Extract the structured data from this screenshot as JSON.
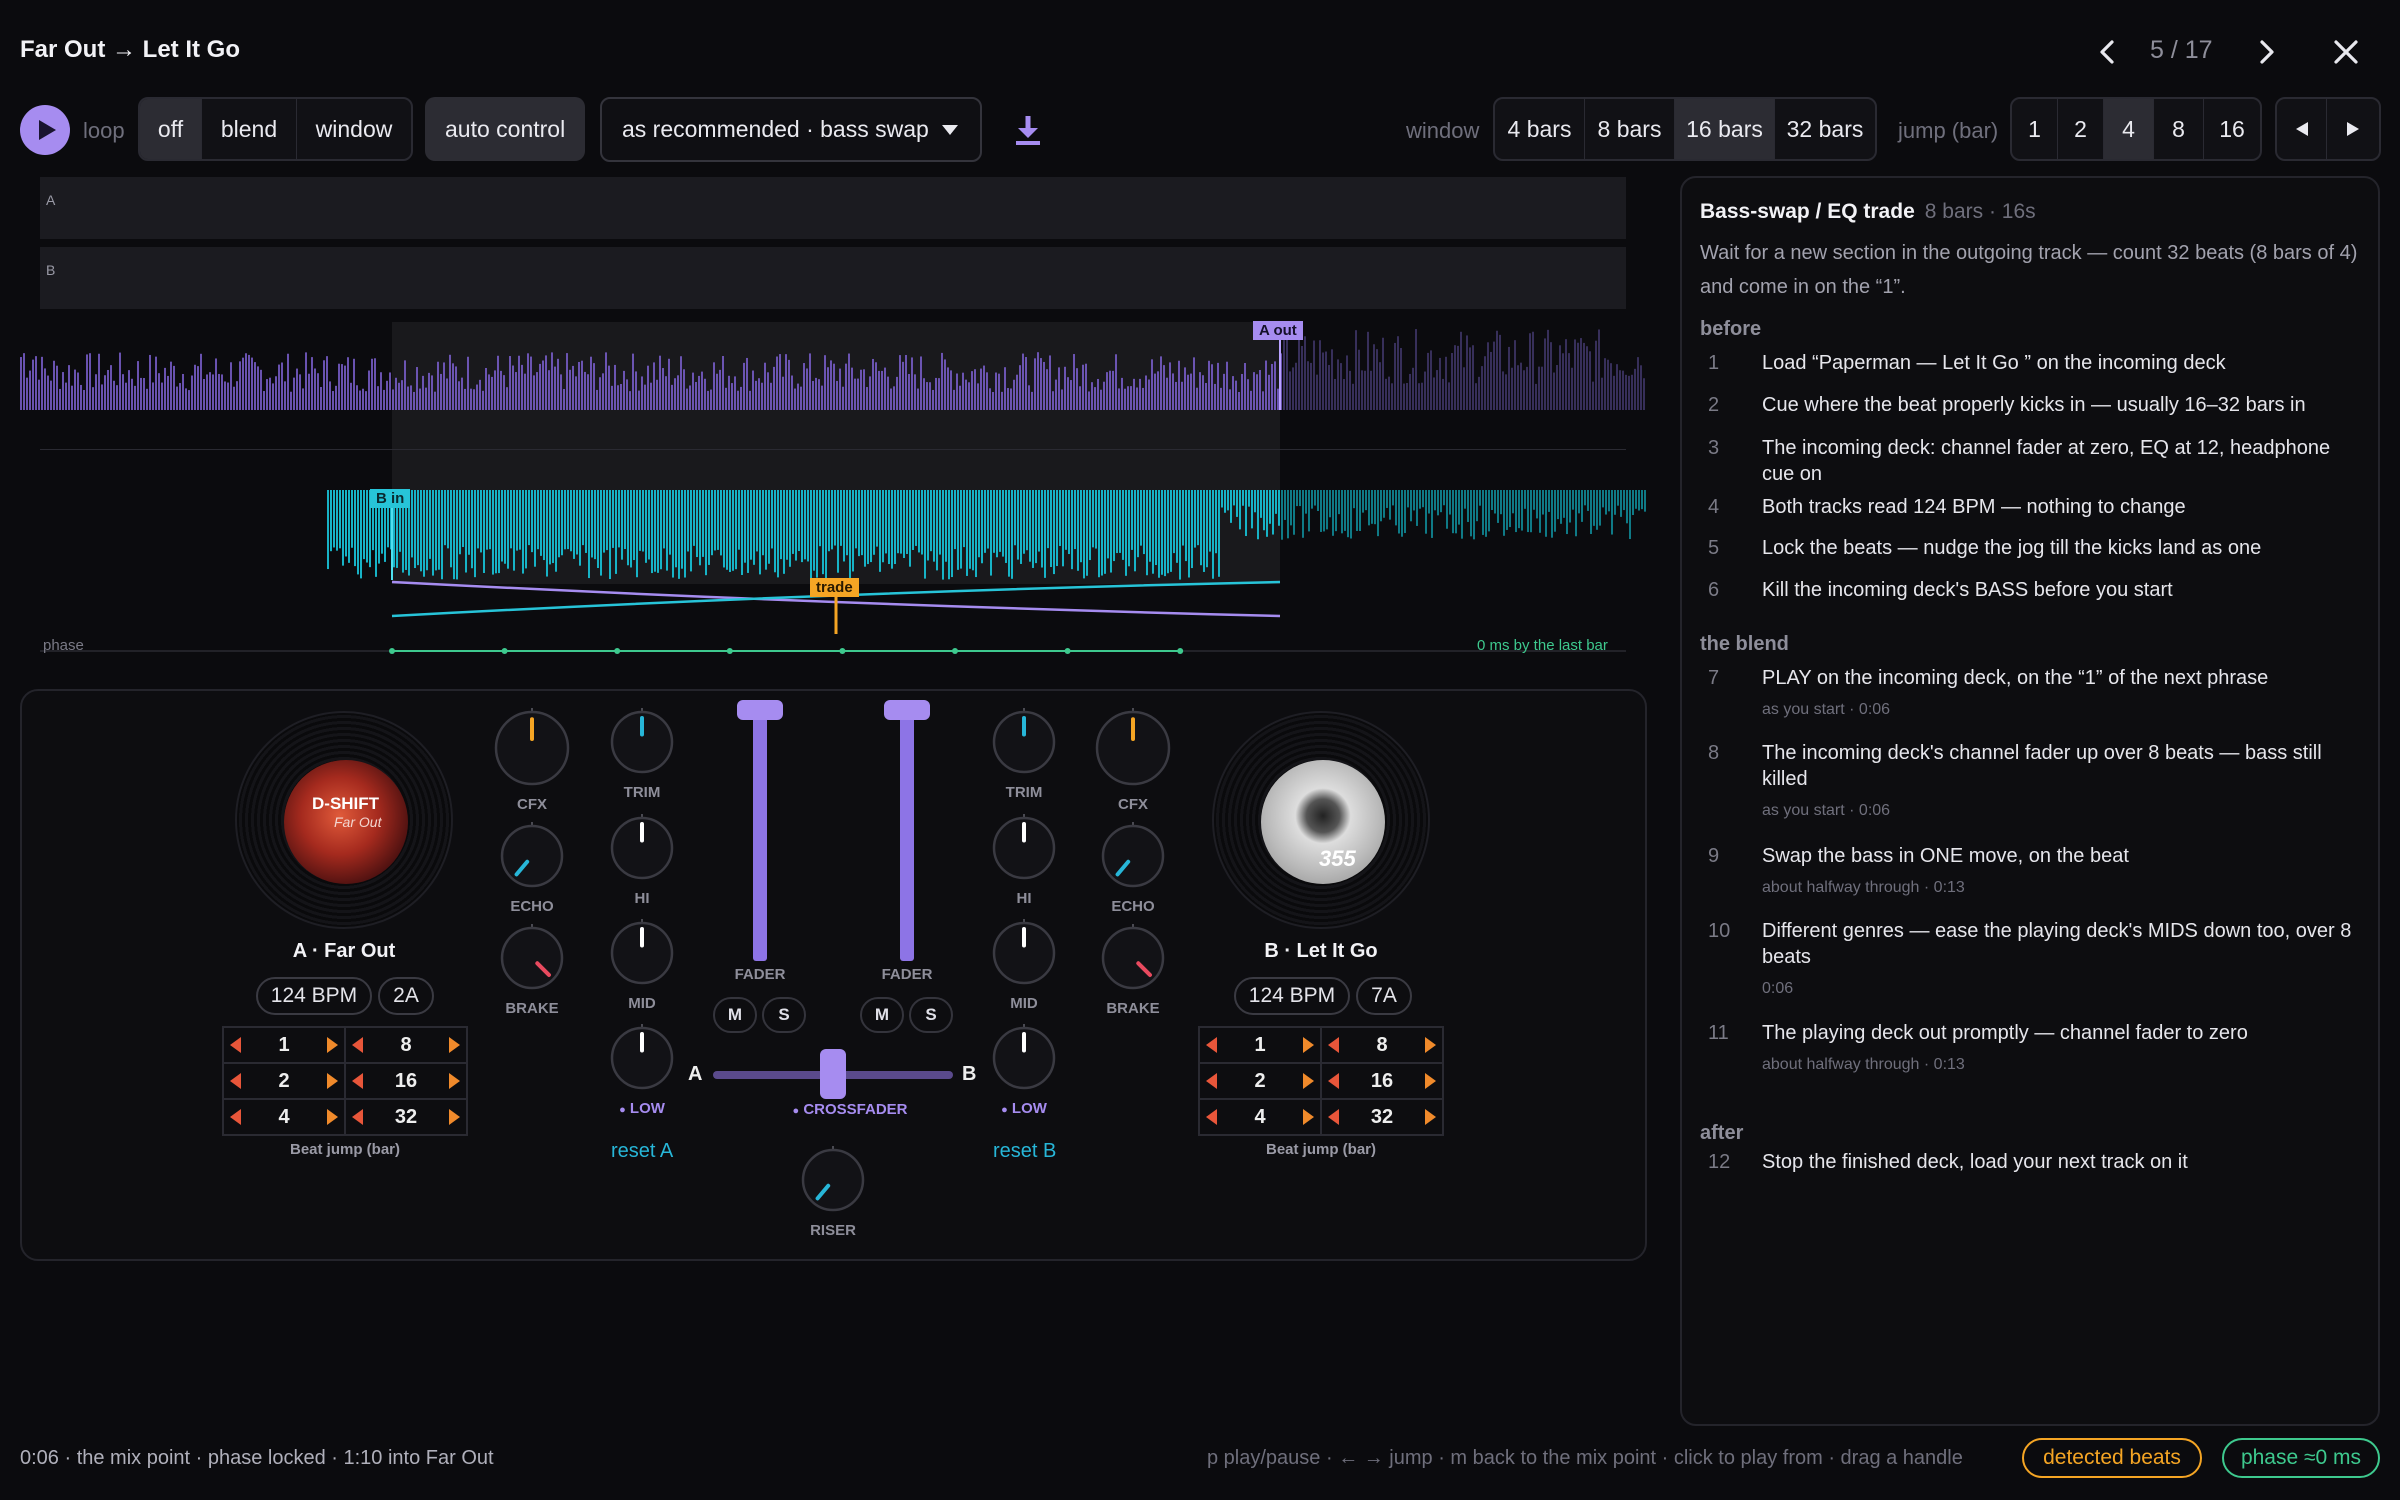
{
  "header": {
    "title": "Far Out → Let It Go",
    "pager": "5 / 17"
  },
  "toolbar": {
    "loop_label": "loop",
    "loop_options": [
      "off",
      "blend",
      "window"
    ],
    "loop_selected": "off",
    "auto_control": "auto control",
    "recommendation": "as recommended · bass swap",
    "window_label": "window",
    "window_options": [
      "4 bars",
      "8 bars",
      "16 bars",
      "32 bars"
    ],
    "window_selected": "16 bars",
    "jump_label": "jump (bar)",
    "jump_options": [
      "1",
      "2",
      "4",
      "8",
      "16"
    ],
    "jump_selected": "4"
  },
  "timeline": {
    "lane_a": "A",
    "lane_b": "B",
    "marker_a_out": "A out",
    "marker_b_in": "B in",
    "marker_trade": "trade",
    "phase_label": "phase",
    "phase_value": "0 ms by the last bar"
  },
  "deck_a": {
    "name": "A · Far Out",
    "bpm": "124 BPM",
    "key": "2A",
    "art_text_1": "D-SHIFT",
    "art_text_2": "Far Out",
    "jumps_left": [
      "1",
      "2",
      "4"
    ],
    "jumps_right": [
      "8",
      "16",
      "32"
    ],
    "beat_jump_label": "Beat jump (bar)",
    "reset": "reset A"
  },
  "deck_b": {
    "name": "B · Let It Go",
    "bpm": "124 BPM",
    "key": "7A",
    "art_text_1": "355",
    "jumps_left": [
      "1",
      "2",
      "4"
    ],
    "jumps_right": [
      "8",
      "16",
      "32"
    ],
    "beat_jump_label": "Beat jump (bar)",
    "reset": "reset B"
  },
  "mixer": {
    "cfx": "CFX",
    "echo": "ECHO",
    "brake": "BRAKE",
    "trim": "TRIM",
    "hi": "HI",
    "mid": "MID",
    "low": "LOW",
    "fader": "FADER",
    "mute": "M",
    "solo": "S",
    "crossfader": "CROSSFADER",
    "cf_a": "A",
    "cf_b": "B",
    "riser": "RISER"
  },
  "steps": {
    "title": "Bass-swap / EQ trade",
    "subtitle": "8 bars · 16s",
    "description": "Wait for a new section in the outgoing track — count 32 beats (8 bars of 4) and come in on the “1”.",
    "sections": [
      {
        "name": "before",
        "items": [
          {
            "n": "1",
            "text": "Load “Paperman — Let It Go ” on the incoming deck",
            "sub": ""
          },
          {
            "n": "2",
            "text": "Cue where the beat properly kicks in — usually 16–32 bars in",
            "sub": ""
          },
          {
            "n": "3",
            "text": "The incoming deck: channel fader at zero, EQ at 12, headphone cue on",
            "sub": ""
          },
          {
            "n": "4",
            "text": "Both tracks read 124 BPM — nothing to change",
            "sub": ""
          },
          {
            "n": "5",
            "text": "Lock the beats — nudge the jog till the kicks land as one",
            "sub": ""
          },
          {
            "n": "6",
            "text": "Kill the incoming deck's BASS before you start",
            "sub": ""
          }
        ]
      },
      {
        "name": "the blend",
        "items": [
          {
            "n": "7",
            "text": "PLAY on the incoming deck, on the “1” of the next phrase",
            "sub": "as you start · 0:06"
          },
          {
            "n": "8",
            "text": "The incoming deck's channel fader up over 8 beats — bass still killed",
            "sub": "as you start · 0:06"
          },
          {
            "n": "9",
            "text": "Swap the bass in ONE move, on the beat",
            "sub": "about halfway through · 0:13"
          },
          {
            "n": "10",
            "text": "Different genres — ease the playing deck's MIDS down too, over 8 beats",
            "sub": "0:06"
          },
          {
            "n": "11",
            "text": "The playing deck out promptly — channel fader to zero",
            "sub": "about halfway through · 0:13"
          }
        ]
      },
      {
        "name": "after",
        "items": [
          {
            "n": "12",
            "text": "Stop the finished deck, load your next track on it",
            "sub": ""
          }
        ]
      }
    ]
  },
  "status": {
    "left": "0:06 · the mix point · phase locked · 1:10 into Far Out",
    "hints": "p play/pause · ← → jump · m back to the mix point · click to play from · drag a handle",
    "badge_beats": "detected beats",
    "badge_phase": "phase ≈0 ms"
  },
  "colors": {
    "accent": "#a68cf0",
    "deck_a_wave": "#8b6fd6",
    "deck_b_wave": "#1fc3d8",
    "trade": "#f5a524",
    "phase_ok": "#3ec98e"
  }
}
